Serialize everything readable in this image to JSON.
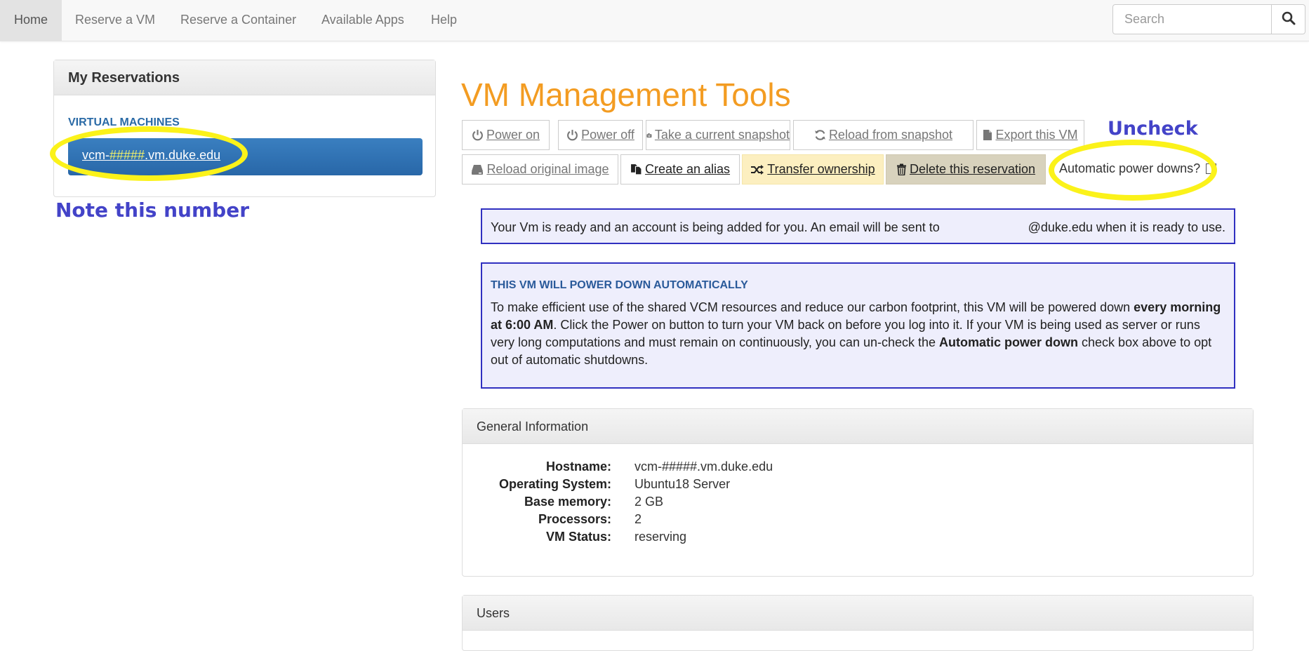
{
  "nav": {
    "items": [
      "Home",
      "Reserve a VM",
      "Reserve a Container",
      "Available Apps",
      "Help"
    ],
    "active": "Home",
    "search_placeholder": "Search"
  },
  "reservations": {
    "title": "My Reservations",
    "section_label": "VIRTUAL MACHINES",
    "vm_prefix": "vcm-",
    "vm_highlight": "#####",
    "vm_suffix": ".vm.duke.edu"
  },
  "annotations": {
    "note_number": "Note this number",
    "uncheck": "Uncheck",
    "highlight_color": "#fbf21a",
    "text_color": "#4343c8"
  },
  "main": {
    "title": "VM Management Tools",
    "title_color": "#f39c22",
    "buttons": {
      "power_on": "Power on",
      "power_off": "Power off",
      "snapshot": "Take a current snapshot",
      "reload_snapshot": "Reload from snapshot",
      "export": "Export this VM",
      "reload_image": "Reload original image",
      "alias": "Create an alias",
      "transfer": "Transfer ownership",
      "delete": "Delete this reservation"
    },
    "auto_power_label": "Automatic power downs?",
    "auto_power_checked": false,
    "ready_alert": {
      "left": "Your Vm is ready and an account is being added for you. An email will be sent to",
      "right": "@duke.edu when it is ready to use."
    },
    "power_alert": {
      "title": "THIS VM WILL POWER DOWN AUTOMATICALLY",
      "t1": "To make efficient use of the shared VCM resources and reduce our carbon footprint, this VM will be powered down ",
      "b1": "every morning at 6:00 AM",
      "t2": ". Click the Power on button to turn your VM back on before you log into it. If your VM is being used as server or runs very long computations and must remain on continuously, you can un-check the ",
      "b2": "Automatic power down",
      "t3": " check box above to opt out of automatic shutdowns."
    }
  },
  "general_info": {
    "title": "General Information",
    "rows": [
      {
        "label": "Hostname:",
        "value": "vcm-#####.vm.duke.edu"
      },
      {
        "label": "Operating System:",
        "value": "Ubuntu18 Server"
      },
      {
        "label": "Base memory:",
        "value": "2 GB"
      },
      {
        "label": "Processors:",
        "value": "2"
      },
      {
        "label": "VM Status:",
        "value": "reserving"
      }
    ]
  },
  "users_panel": {
    "title": "Users"
  }
}
